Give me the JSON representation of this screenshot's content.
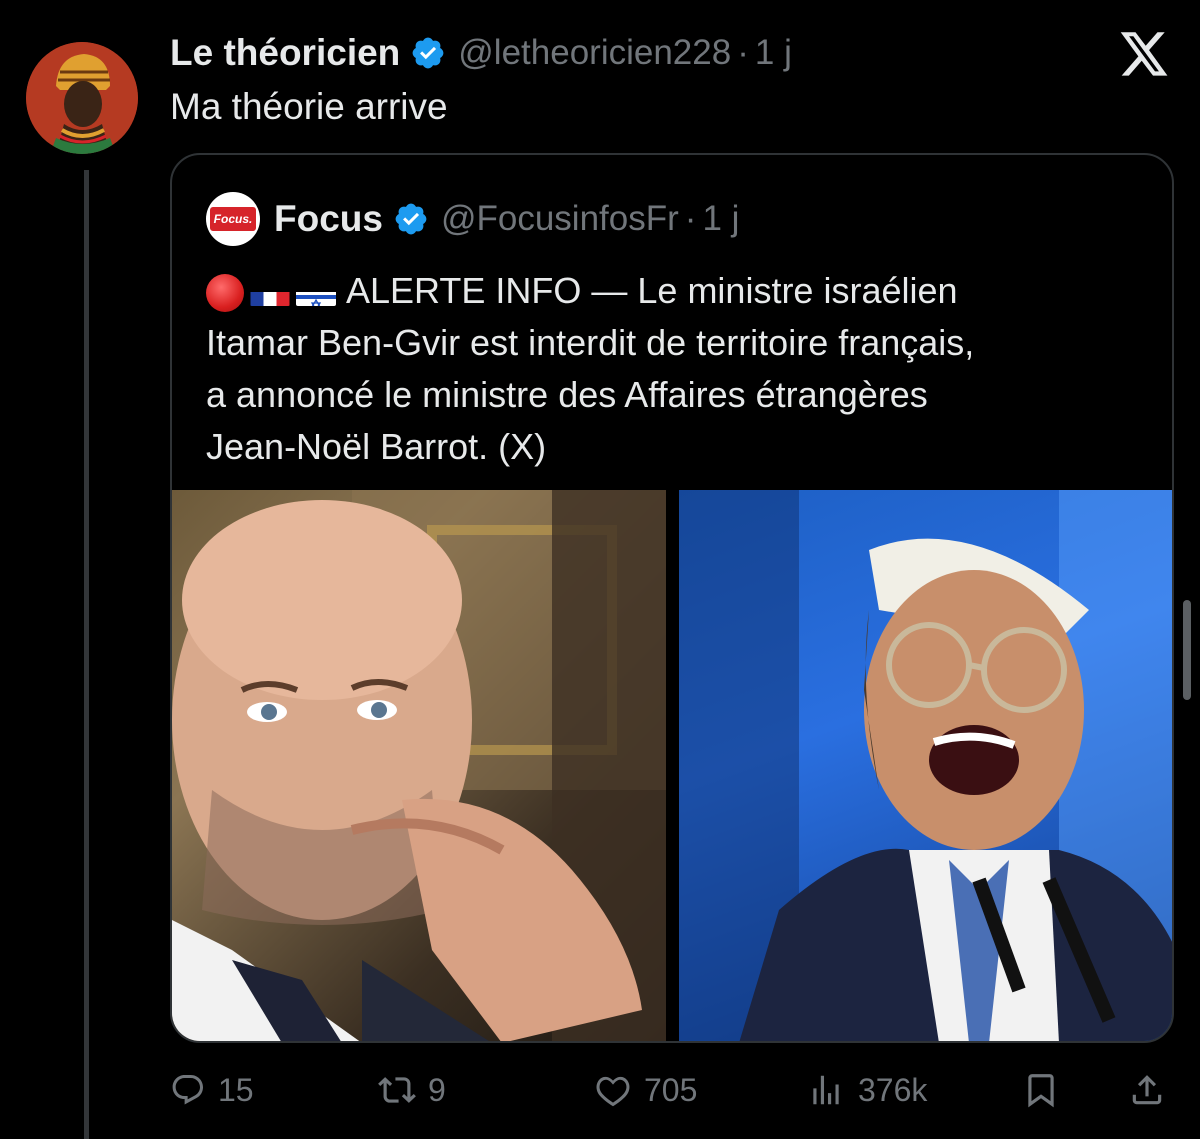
{
  "post": {
    "author_name": "Le théoricien",
    "handle": "@letheoricien228",
    "separator": "·",
    "time": "1 j",
    "text": "Ma théorie arrive"
  },
  "quote": {
    "logo_text": "Focus.",
    "author_name": "Focus",
    "handle": "@FocusinfosFr",
    "separator": "·",
    "time": "1 j",
    "lines": [
      "ALERTE INFO — Le ministre israélien",
      "Itamar Ben-Gvir est interdit de territoire français,",
      "a annoncé le ministre des Affaires étrangères",
      "Jean-Noël Barrot. (X)"
    ],
    "emojis": [
      "red-circle",
      "flag-france",
      "flag-israel"
    ]
  },
  "actions": {
    "replies": "15",
    "reposts": "9",
    "likes": "705",
    "views": "376k"
  },
  "icons": {
    "verified": "verified-badge-icon",
    "platform": "x-logo-icon",
    "reply": "reply-icon",
    "repost": "repost-icon",
    "like": "heart-icon",
    "views": "views-icon",
    "bookmark": "bookmark-icon",
    "share": "share-icon"
  },
  "colors": {
    "background": "#000000",
    "text": "#e7e9ea",
    "muted": "#71767b",
    "verified": "#1d9bf0",
    "border": "#2f3336"
  }
}
